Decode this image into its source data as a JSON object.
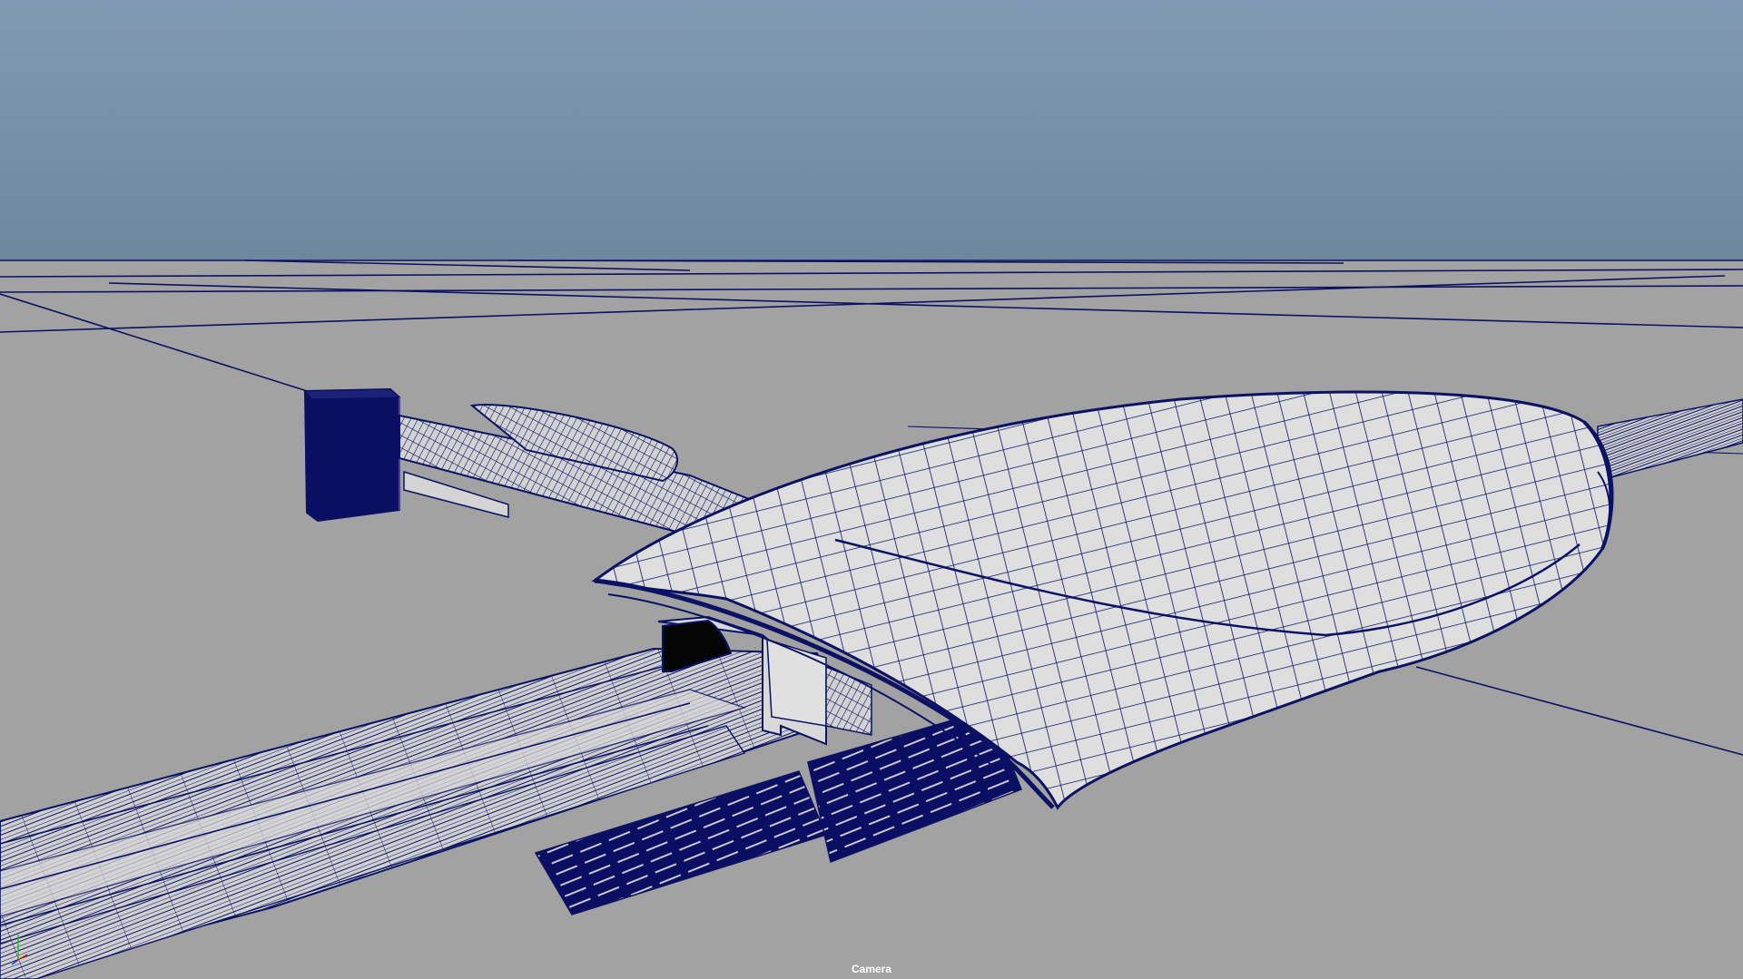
{
  "viewport": {
    "camera_label": "Camera",
    "axis_gizmo_icon": "xyz-axis-gizmo-icon"
  },
  "colors": {
    "sky_top": "#8299b4",
    "sky_bottom": "#6e869e",
    "ground": "#a2a2a2",
    "wire": "#0b1163",
    "surface": "#dadada",
    "dark_fill": "#0a0f63",
    "opening": "#050505"
  }
}
